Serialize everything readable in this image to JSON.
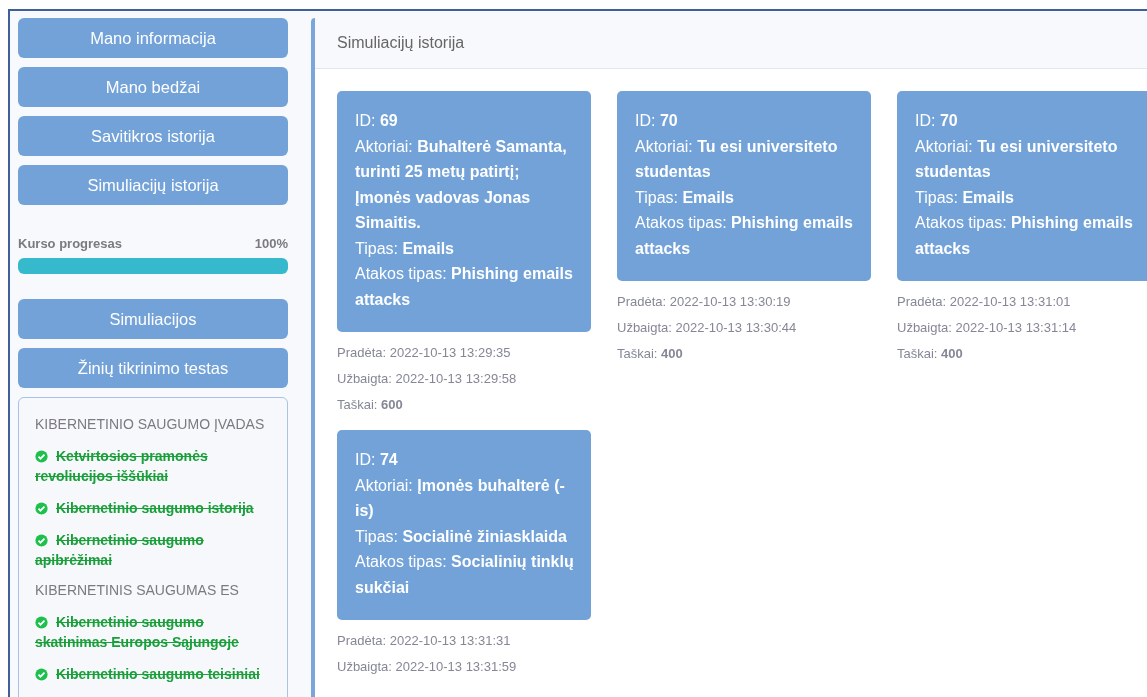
{
  "sidebar": {
    "nav_buttons": [
      "Mano informacija",
      "Mano bedžai",
      "Savitikros istorija",
      "Simuliacijų istorija"
    ],
    "progress": {
      "label": "Kurso progresas",
      "reading": "100%",
      "level": 1
    },
    "action_buttons": [
      "Simuliacijos",
      "Žinių tikrinimo testas"
    ],
    "course": [
      {
        "title": "KIBERNETINIO SAUGUMO ĮVADAS",
        "lessons": [
          {
            "label": "Ketvirtosios pramonės revoliucijos iššūkiai",
            "completed": true
          },
          {
            "label": "Kibernetinio saugumo istorija",
            "completed": true
          },
          {
            "label": "Kibernetinio saugumo apibrėžimai",
            "completed": true
          }
        ]
      },
      {
        "title": "KIBERNETINIS SAUGUMAS ES",
        "lessons": [
          {
            "label": "Kibernetinio saugumo skatinimas Europos Sąjungoje",
            "completed": true
          },
          {
            "label": "Kibernetinio saugumo teisiniai",
            "completed": true
          }
        ]
      }
    ]
  },
  "panel": {
    "title": "Simuliacijų istorija",
    "simulations": [
      {
        "lines": [
          "ID: **69**",
          "Aktoriai: **Buhalterė Samanta, turinti 25 metų patirtį; Įmonės vadovas Jonas Simaitis.**",
          "Tipas: **Emails**",
          "Atakos tipas: **Phishing emails attacks**"
        ],
        "meta": [
          "Pradėta: 2022-10-13 13:29:35",
          "Užbaigta: 2022-10-13 13:29:58",
          "Taškai: **600**"
        ]
      },
      {
        "lines": [
          "ID: **70**",
          "Aktoriai: **Tu esi universiteto studentas**",
          "Tipas: **Emails**",
          "Atakos tipas: **Phishing emails attacks**"
        ],
        "meta": [
          "Pradėta: 2022-10-13 13:30:19",
          "Užbaigta: 2022-10-13 13:30:44",
          "Taškai: **400**"
        ]
      },
      {
        "lines": [
          "ID: **70**",
          "Aktoriai: **Tu esi universiteto studentas**",
          "Tipas: **Emails**",
          "Atakos tipas: **Phishing emails attacks**"
        ],
        "meta": [
          "Pradėta: 2022-10-13 13:31:01",
          "Užbaigta: 2022-10-13 13:31:14",
          "Taškai: **400**"
        ]
      },
      {
        "lines": [
          "ID: **74**",
          "Aktoriai: **Įmonės buhalterė (-is)**",
          "Tipas: **Socialinė žiniasklaida**",
          "Atakos tipas: **Socialinių tinklų sukčiai**"
        ],
        "meta": [
          "Pradėta: 2022-10-13 13:31:31",
          "Užbaigta: 2022-10-13 13:31:59"
        ]
      }
    ]
  }
}
